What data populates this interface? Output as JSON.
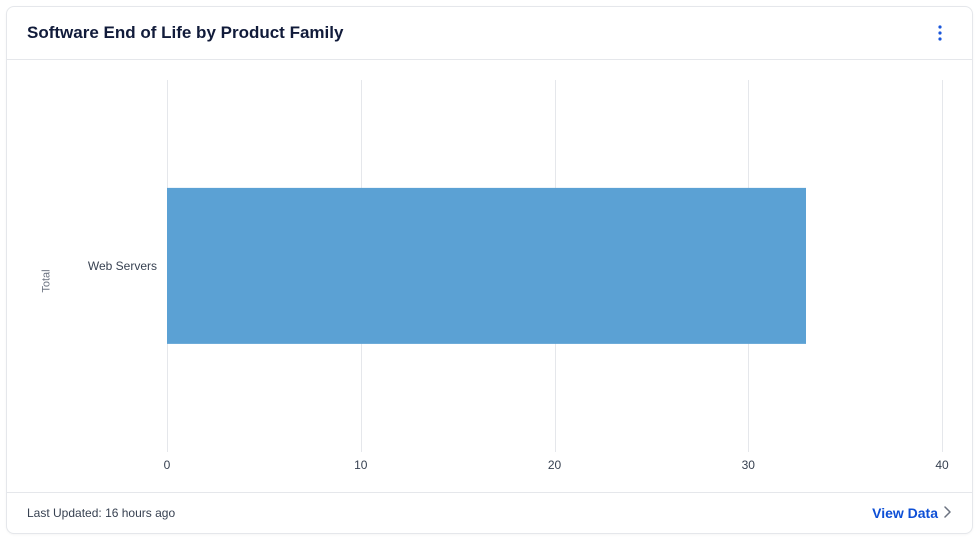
{
  "header": {
    "title": "Software End of Life by Product Family",
    "menu_icon": "more-vertical"
  },
  "footer": {
    "last_updated_prefix": "Last Updated:",
    "last_updated_value": "16 hours ago",
    "view_data_label": "View Data"
  },
  "chart_data": {
    "type": "bar",
    "orientation": "horizontal",
    "categories": [
      "Web Servers"
    ],
    "values": [
      33
    ],
    "ylabel": "Total",
    "xlabel": "",
    "xlim": [
      0,
      40
    ],
    "x_ticks": [
      0,
      10,
      20,
      30,
      40
    ],
    "bar_color": "#5ba1d4",
    "title": ""
  }
}
